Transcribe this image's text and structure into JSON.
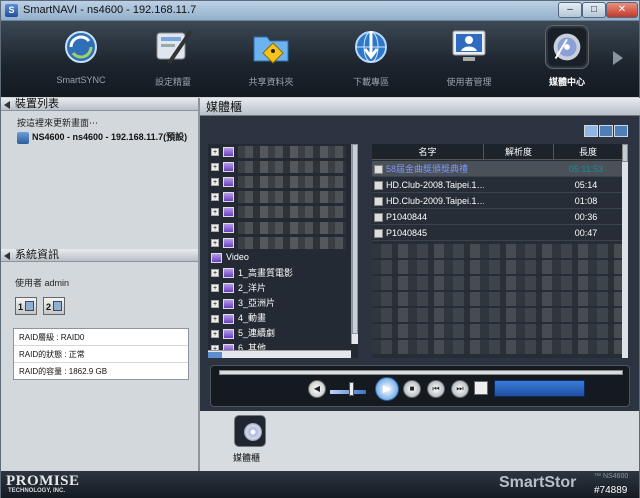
{
  "window": {
    "title": "SmartNAVI - ns4600 - 192.168.11.7"
  },
  "toolbar": {
    "items": [
      {
        "label": "SmartSYNC",
        "icon": "sync-icon"
      },
      {
        "label": "設定精靈",
        "icon": "wizard-icon"
      },
      {
        "label": "共享資料夾",
        "icon": "shared-folder-icon"
      },
      {
        "label": "下載專區",
        "icon": "download-globe-icon"
      },
      {
        "label": "使用者管理",
        "icon": "user-management-icon"
      },
      {
        "label": "媒體中心",
        "icon": "media-center-icon",
        "active": true
      }
    ]
  },
  "device_list": {
    "title": "裝置列表",
    "hint": "按這裡來更新畫面⋯",
    "device": "NS4600 - ns4600 - 192.168.11.7(預設)"
  },
  "system_info": {
    "title": "系統資訊",
    "user": "使用者 admin",
    "disks": [
      "1",
      "2"
    ],
    "raid_level": "RAID層級 : RAID0",
    "raid_status": "RAID的狀態 : 正常",
    "raid_capacity": "RAID的容量 : 1862.9 GB"
  },
  "media": {
    "title": "媒體櫃",
    "tree": {
      "video_label": "Video",
      "folders": [
        "1_高畫質電影",
        "2_洋片",
        "3_亞洲片",
        "4_動畫",
        "5_連續劇",
        "6_其他"
      ]
    },
    "file_list": {
      "columns": [
        "名字",
        "解析度",
        "長度"
      ],
      "rows": [
        {
          "name": "58屆金曲獎頒獎典禮",
          "resolution": "",
          "length": "05:11:53",
          "selected": true
        },
        {
          "name": "HD.Club-2008.Taipei.1…",
          "resolution": "",
          "length": "05:14"
        },
        {
          "name": "HD.Club-2009.Taipei.1…",
          "resolution": "",
          "length": "01:08"
        },
        {
          "name": "P1040844",
          "resolution": "",
          "length": "00:36"
        },
        {
          "name": "P1040845",
          "resolution": "",
          "length": "00:47"
        }
      ]
    },
    "player": {
      "play_symbol": "▶",
      "stop_symbol": "■",
      "prev_symbol": "⏮",
      "next_symbol": "⏭",
      "volume_level": 0.55
    }
  },
  "bottom_tools": {
    "label": "媒體櫃"
  },
  "footer": {
    "brand": "PROMISE",
    "brand_sub": "TECHNOLOGY, INC.",
    "product": "SmartStor",
    "product_sub": "™ NS4600",
    "tag": "#74889"
  },
  "colors": {
    "accent": "#3f8ee0",
    "selected_text": "#7f96ff",
    "toolbar_bg": "#1b232c"
  }
}
